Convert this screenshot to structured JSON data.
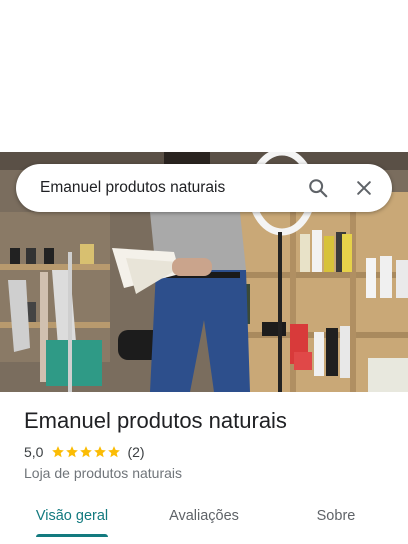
{
  "search": {
    "query": "Emanuel produtos naturais",
    "icon": "search-icon",
    "clear_icon": "close-icon"
  },
  "place": {
    "name": "Emanuel produtos naturais",
    "rating": "5,0",
    "star_count": 5,
    "reviews": "(2)",
    "category": "Loja de produtos naturais",
    "star_color": "#fbbc04"
  },
  "tabs": [
    {
      "label": "Visão geral",
      "active": true
    },
    {
      "label": "Avaliações",
      "active": false
    },
    {
      "label": "Sobre",
      "active": false
    }
  ],
  "accent_color": "#137a7f"
}
